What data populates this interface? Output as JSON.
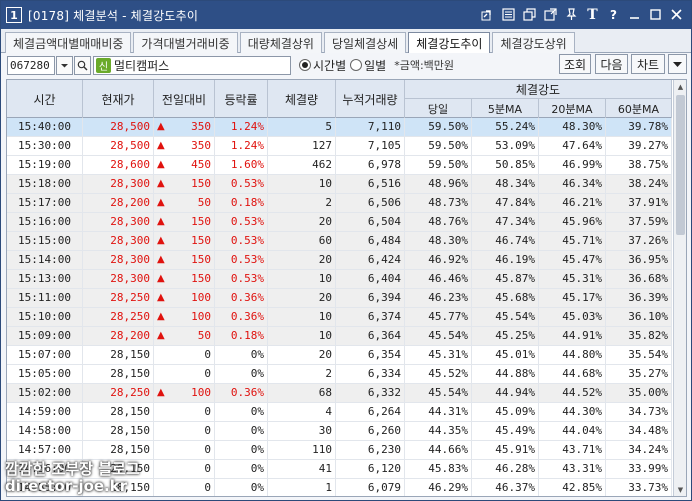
{
  "window": {
    "number": "1",
    "title": "[0178] 체결분석 - 체결강도추이"
  },
  "title_icons": [
    "link-icon",
    "window-list-icon",
    "restore-icon",
    "popout-icon",
    "pin-icon",
    "font-icon",
    "help-icon",
    "minimize-icon",
    "maximize-icon",
    "close-icon"
  ],
  "tabs": [
    {
      "label": "체결금액대별매매비중",
      "active": false
    },
    {
      "label": "가격대별거래비중",
      "active": false
    },
    {
      "label": "대량체결상위",
      "active": false
    },
    {
      "label": "당일체결상세",
      "active": false
    },
    {
      "label": "체결강도추이",
      "active": true
    },
    {
      "label": "체결강도상위",
      "active": false
    }
  ],
  "toolbar": {
    "stock_code": "067280",
    "credit_badge": "신",
    "stock_name": "멀티캠퍼스",
    "radio_time": "시간별",
    "radio_daily": "일별",
    "selected_radio": "시간별",
    "unit_note": "*금액:백만원",
    "query_label": "조회",
    "next_label": "다음",
    "chart_label": "차트"
  },
  "grid": {
    "headers": {
      "time": "시간",
      "price": "현재가",
      "change": "전일대비",
      "rate": "등락률",
      "volume": "체결량",
      "cum_volume": "누적거래량",
      "strength_group": "체결강도",
      "today": "당일",
      "ma5": "5분MA",
      "ma20": "20분MA",
      "ma60": "60분MA"
    },
    "rows": [
      {
        "time": "15:40:00",
        "price": "28,500",
        "up": true,
        "change": "350",
        "rate": "1.24%",
        "volume": "5",
        "cum": "7,110",
        "today": "59.50%",
        "ma5": "55.24%",
        "ma20": "48.30%",
        "ma60": "39.78%"
      },
      {
        "time": "15:30:00",
        "price": "28,500",
        "up": true,
        "change": "350",
        "rate": "1.24%",
        "volume": "127",
        "cum": "7,105",
        "today": "59.50%",
        "ma5": "53.09%",
        "ma20": "47.64%",
        "ma60": "39.27%"
      },
      {
        "time": "15:19:00",
        "price": "28,600",
        "up": true,
        "change": "450",
        "rate": "1.60%",
        "volume": "462",
        "cum": "6,978",
        "today": "59.50%",
        "ma5": "50.85%",
        "ma20": "46.99%",
        "ma60": "38.75%"
      },
      {
        "time": "15:18:00",
        "price": "28,300",
        "up": true,
        "change": "150",
        "rate": "0.53%",
        "volume": "10",
        "cum": "6,516",
        "today": "48.96%",
        "ma5": "48.34%",
        "ma20": "46.34%",
        "ma60": "38.24%"
      },
      {
        "time": "15:17:00",
        "price": "28,200",
        "up": true,
        "change": "50",
        "rate": "0.18%",
        "volume": "2",
        "cum": "6,506",
        "today": "48.73%",
        "ma5": "47.84%",
        "ma20": "46.21%",
        "ma60": "37.91%"
      },
      {
        "time": "15:16:00",
        "price": "28,300",
        "up": true,
        "change": "150",
        "rate": "0.53%",
        "volume": "20",
        "cum": "6,504",
        "today": "48.76%",
        "ma5": "47.34%",
        "ma20": "45.96%",
        "ma60": "37.59%"
      },
      {
        "time": "15:15:00",
        "price": "28,300",
        "up": true,
        "change": "150",
        "rate": "0.53%",
        "volume": "60",
        "cum": "6,484",
        "today": "48.30%",
        "ma5": "46.74%",
        "ma20": "45.71%",
        "ma60": "37.26%"
      },
      {
        "time": "15:14:00",
        "price": "28,300",
        "up": true,
        "change": "150",
        "rate": "0.53%",
        "volume": "20",
        "cum": "6,424",
        "today": "46.92%",
        "ma5": "46.19%",
        "ma20": "45.47%",
        "ma60": "36.95%"
      },
      {
        "time": "15:13:00",
        "price": "28,300",
        "up": true,
        "change": "150",
        "rate": "0.53%",
        "volume": "10",
        "cum": "6,404",
        "today": "46.46%",
        "ma5": "45.87%",
        "ma20": "45.31%",
        "ma60": "36.68%"
      },
      {
        "time": "15:11:00",
        "price": "28,250",
        "up": true,
        "change": "100",
        "rate": "0.36%",
        "volume": "20",
        "cum": "6,394",
        "today": "46.23%",
        "ma5": "45.68%",
        "ma20": "45.17%",
        "ma60": "36.39%"
      },
      {
        "time": "15:10:00",
        "price": "28,250",
        "up": true,
        "change": "100",
        "rate": "0.36%",
        "volume": "10",
        "cum": "6,374",
        "today": "45.77%",
        "ma5": "45.54%",
        "ma20": "45.03%",
        "ma60": "36.10%"
      },
      {
        "time": "15:09:00",
        "price": "28,200",
        "up": true,
        "change": "50",
        "rate": "0.18%",
        "volume": "10",
        "cum": "6,364",
        "today": "45.54%",
        "ma5": "45.25%",
        "ma20": "44.91%",
        "ma60": "35.82%"
      },
      {
        "time": "15:07:00",
        "price": "28,150",
        "up": false,
        "change": "0",
        "rate": "0%",
        "volume": "20",
        "cum": "6,354",
        "today": "45.31%",
        "ma5": "45.01%",
        "ma20": "44.80%",
        "ma60": "35.54%"
      },
      {
        "time": "15:05:00",
        "price": "28,150",
        "up": false,
        "change": "0",
        "rate": "0%",
        "volume": "2",
        "cum": "6,334",
        "today": "45.52%",
        "ma5": "44.88%",
        "ma20": "44.68%",
        "ma60": "35.27%"
      },
      {
        "time": "15:02:00",
        "price": "28,250",
        "up": true,
        "change": "100",
        "rate": "0.36%",
        "volume": "68",
        "cum": "6,332",
        "today": "45.54%",
        "ma5": "44.94%",
        "ma20": "44.52%",
        "ma60": "35.00%"
      },
      {
        "time": "14:59:00",
        "price": "28,150",
        "up": false,
        "change": "0",
        "rate": "0%",
        "volume": "4",
        "cum": "6,264",
        "today": "44.31%",
        "ma5": "45.09%",
        "ma20": "44.30%",
        "ma60": "34.73%"
      },
      {
        "time": "14:58:00",
        "price": "28,150",
        "up": false,
        "change": "0",
        "rate": "0%",
        "volume": "30",
        "cum": "6,260",
        "today": "44.35%",
        "ma5": "45.49%",
        "ma20": "44.04%",
        "ma60": "34.48%"
      },
      {
        "time": "14:57:00",
        "price": "28,150",
        "up": false,
        "change": "0",
        "rate": "0%",
        "volume": "110",
        "cum": "6,230",
        "today": "44.66%",
        "ma5": "45.91%",
        "ma20": "43.71%",
        "ma60": "34.24%"
      },
      {
        "time": "14:56:00",
        "price": "28,150",
        "up": false,
        "change": "0",
        "rate": "0%",
        "volume": "41",
        "cum": "6,120",
        "today": "45.83%",
        "ma5": "46.28%",
        "ma20": "43.31%",
        "ma60": "33.99%"
      },
      {
        "time": "14:55:00",
        "price": "28,150",
        "up": false,
        "change": "0",
        "rate": "0%",
        "volume": "1",
        "cum": "6,079",
        "today": "46.29%",
        "ma5": "46.37%",
        "ma20": "42.85%",
        "ma60": "33.73%"
      }
    ]
  },
  "watermark": {
    "line1": "깜깜한 조부장 블로그",
    "line2": "director-joe.kr"
  }
}
